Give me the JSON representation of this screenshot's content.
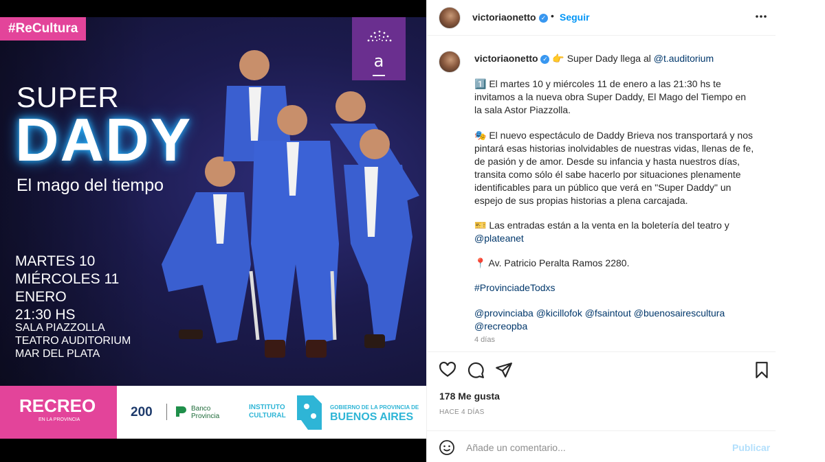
{
  "poster": {
    "hashtag": "#ReCultura",
    "badge_letter": "a",
    "title_top": "SUPER",
    "title_main": "DADY",
    "subtitle": "El mago del tiempo",
    "dates": [
      "MARTES 10",
      "MIÉRCOLES 11",
      "ENERO",
      "21:30 HS"
    ],
    "venue": [
      "SALA PIAZZOLLA",
      "TEATRO AUDITORIUM",
      "MAR DEL PLATA"
    ],
    "sponsors": {
      "recreo": "RECREO",
      "recreo_sub": "EN LA PROVINCIA",
      "bicentenario": "200",
      "banco_line1": "Banco",
      "banco_line2": "Provincia",
      "instituto_line1": "INSTITUTO",
      "instituto_line2": "CULTURAL",
      "gobierno": "GOBIERNO DE LA PROVINCIA DE",
      "buenos_aires": "BUENOS AIRES"
    },
    "colors": {
      "pink": "#e3449a",
      "purple": "#6a2f8f",
      "cyan": "#2eb5d6",
      "suit_blue": "#3a5fd0"
    }
  },
  "header": {
    "username": "victoriaonetto",
    "separator": "•",
    "follow_label": "Seguir",
    "more_icon": "more-horizontal-icon"
  },
  "caption": {
    "username": "victoriaonetto",
    "first_line_emoji": "👉",
    "first_line_text": "Super Dady llega al",
    "first_line_mention": "@t.auditorium",
    "p1": [
      "1️⃣ El martes 10 y miércoles 11 de enero a las 21:30 hs te",
      "invitamos a la nueva obra Super Daddy, El Mago del Tiempo en",
      "la sala Astor Piazzolla."
    ],
    "p2": [
      "🎭 El nuevo espectáculo de Daddy Brieva nos transportará y nos",
      "pintará esas historias inolvidables de nuestras vidas, llenas de fe,",
      "de pasión y de amor. Desde su infancia y hasta nuestros días,",
      "transita como sólo él sabe hacerlo por situaciones plenamente",
      "identificables para un público que verá en \"Super Daddy\" un",
      "espejo de sus propias historias a plena carcajada."
    ],
    "p3_line1": "🎫 Las entradas están a la venta en la boletería del teatro y",
    "p3_mention": "@plateanet",
    "p4": "📍 Av. Patricio Peralta Ramos 2280.",
    "hashtag": "#ProvinciadeTodxs",
    "mentions_line1": "@provinciaba @kicillofok @fsaintout @buenosairescultura",
    "mentions_line2": "@recreopba",
    "time": "4 días"
  },
  "actions": {
    "icons": [
      "heart-icon",
      "comment-icon",
      "share-icon",
      "bookmark-icon"
    ],
    "likes": "178 Me gusta",
    "ago": "HACE 4 DÍAS"
  },
  "comment": {
    "placeholder": "Añade un comentario...",
    "publish_label": "Publicar"
  }
}
